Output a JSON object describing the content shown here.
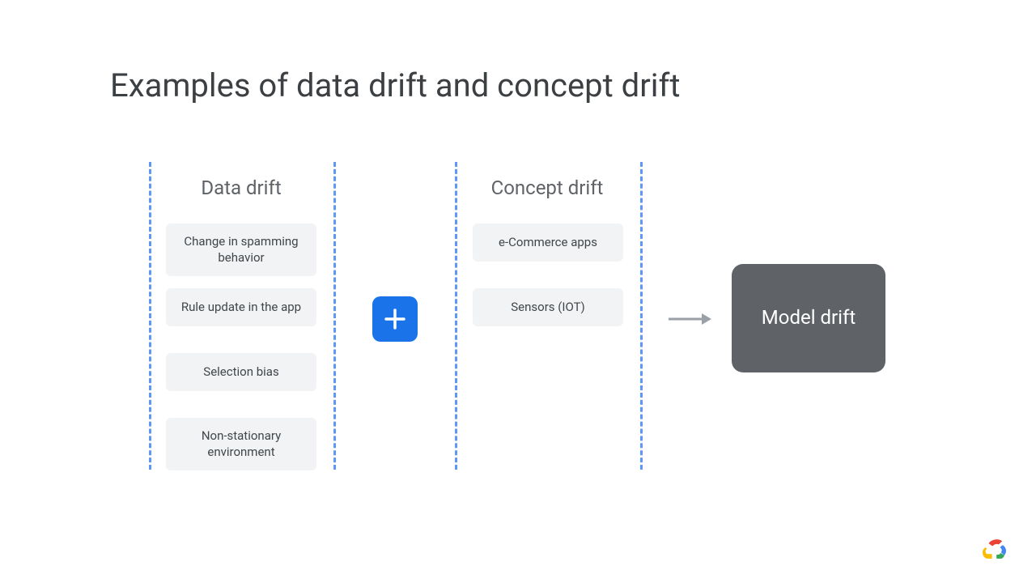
{
  "title": "Examples of data drift and concept drift",
  "columns": {
    "data_drift": {
      "heading": "Data drift",
      "items": [
        "Change in spamming behavior",
        "Rule update in the app",
        "Selection bias",
        "Non-stationary environment"
      ]
    },
    "concept_drift": {
      "heading": "Concept drift",
      "items": [
        "e-Commerce apps",
        "Sensors (IOT)"
      ]
    }
  },
  "operator": "+",
  "result": "Model drift",
  "colors": {
    "accent_blue": "#1a73e8",
    "dashed_blue": "#4285f4",
    "card_bg": "#f1f3f4",
    "result_bg": "#5f6368",
    "text": "#3c4043"
  }
}
